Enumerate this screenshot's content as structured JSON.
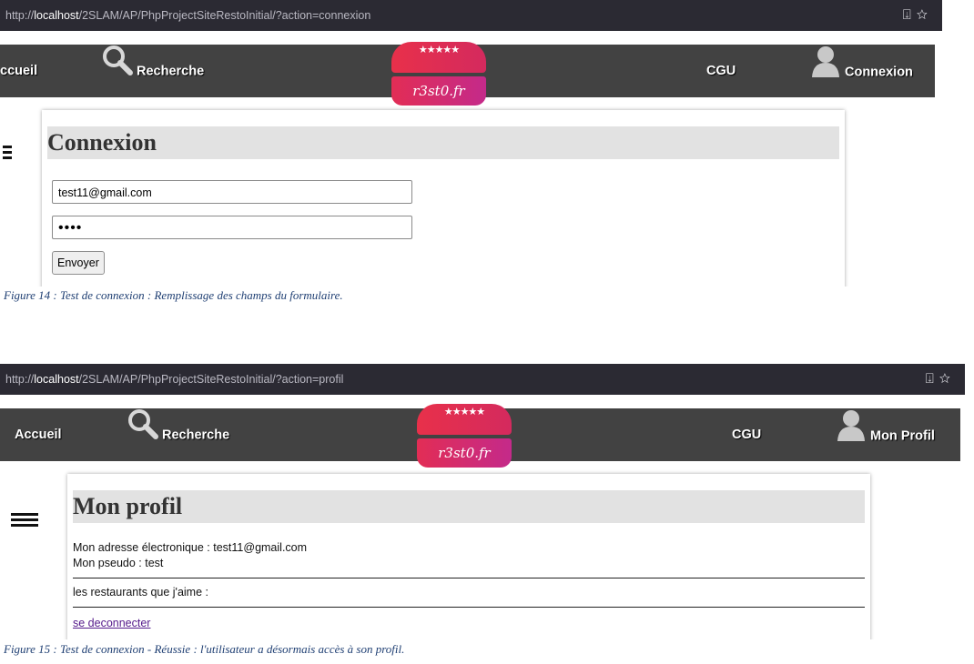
{
  "icons": {
    "download": "download-icon",
    "bookmark": "star-outline-icon",
    "search": "magnifier-icon",
    "user": "user-silhouette-icon",
    "menu": "hamburger-icon"
  },
  "logo": {
    "stars": "★★★★★",
    "text": "r3st0.fr"
  },
  "screenshot1": {
    "url": {
      "prefix": "http://",
      "host": "localhost",
      "path": "/2SLAM/AP/PhpProjectSiteRestoInitial/?action=connexion"
    },
    "nav": {
      "home": "ccueil",
      "search": "Recherche",
      "cgu": "CGU",
      "account": "Connexion"
    },
    "form": {
      "title": "Connexion",
      "email_value": "test11@gmail.com",
      "password_mask": "••••",
      "submit_label": "Envoyer"
    },
    "caption": "Figure 14 : Test de connexion : Remplissage des champs du formulaire."
  },
  "screenshot2": {
    "url": {
      "prefix": "http://",
      "host": "localhost",
      "path": "/2SLAM/AP/PhpProjectSiteRestoInitial/?action=profil"
    },
    "nav": {
      "home": "Accueil",
      "search": "Recherche",
      "cgu": "CGU",
      "account": "Mon Profil"
    },
    "profile": {
      "title": "Mon profil",
      "email_line": "Mon adresse électronique : test11@gmail.com",
      "pseudo_line": "Mon pseudo : test",
      "liked_line": "les restaurants que j'aime :",
      "logout_link": "se deconnecter"
    },
    "caption": "Figure 15 : Test de connexion - Réussie : l'utilisateur a désormais accès à son profil."
  },
  "colors": {
    "navbar": "#424242",
    "urlbar": "#2b2a33",
    "caption": "#1f3f73",
    "link_visited": "#551a8b"
  }
}
